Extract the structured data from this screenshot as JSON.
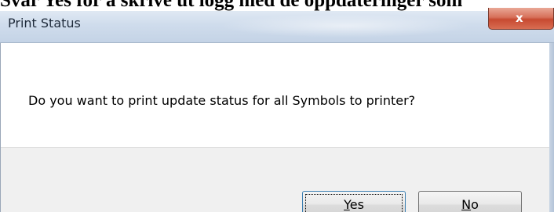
{
  "document": {
    "heading": "Svar Yes for å skrive ut logg med de oppdateringer som"
  },
  "dialog": {
    "title": "Print Status",
    "close_glyph": "x",
    "message": "Do you want to print update status for all Symbols to printer?",
    "buttons": {
      "yes": {
        "mnemonic": "Y",
        "rest": "es"
      },
      "no": {
        "mnemonic": "N",
        "rest": "o"
      }
    }
  },
  "colors": {
    "titlebar": "#cfdcec",
    "close_button": "#c74a31",
    "footer": "#f0f0f0",
    "default_button_border": "#3c7fb1"
  },
  "icons": [
    "close-icon"
  ]
}
